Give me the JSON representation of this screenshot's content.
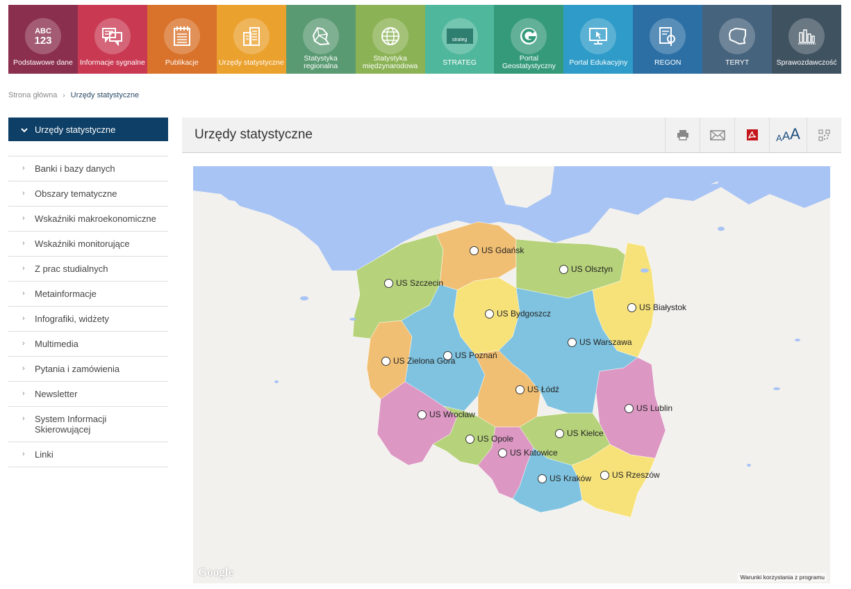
{
  "tiles": [
    {
      "label": "Podstawowe dane",
      "color": "#8b2f4f",
      "icon": "abc-123-icon",
      "icon_text": "ABC\n123"
    },
    {
      "label": "Informacje sygnalne",
      "color": "#c93a52",
      "icon": "chat-icon"
    },
    {
      "label": "Publikacje",
      "color": "#d9722a",
      "icon": "notebook-icon"
    },
    {
      "label": "Urzędy statystyczne",
      "color": "#eba12e",
      "icon": "buildings-icon"
    },
    {
      "label": "Statystyka regionalna",
      "color": "#5a9a72",
      "icon": "map-regions-icon"
    },
    {
      "label": "Statystyka międzynarodowa",
      "color": "#8bb254",
      "icon": "globe-icon"
    },
    {
      "label": "STRATEG",
      "color": "#4fb79b",
      "icon": "strateg-icon",
      "icon_text": "strateg"
    },
    {
      "label": "Portal Geostatystyczny",
      "color": "#359a7a",
      "icon": "geo-g-icon"
    },
    {
      "label": "Portal Edukacyjny",
      "color": "#2e9bc8",
      "icon": "monitor-cursor-icon"
    },
    {
      "label": "REGON",
      "color": "#2b6fa5",
      "icon": "document-search-icon"
    },
    {
      "label": "TERYT",
      "color": "#46637d",
      "icon": "poland-outline-icon"
    },
    {
      "label": "Sprawozdawczość",
      "color": "#3f5260",
      "icon": "bar-chart-icon"
    }
  ],
  "breadcrumb": {
    "home": "Strona główna",
    "current": "Urzędy statystyczne"
  },
  "sidebar": {
    "active": "Urzędy statystyczne",
    "items": [
      "Banki i bazy danych",
      "Obszary tematyczne",
      "Wskaźniki makroekonomiczne",
      "Wskaźniki monitorujące",
      "Z prac studialnych",
      "Metainformacje",
      "Infografiki, widżety",
      "Multimedia",
      "Pytania i zamówienia",
      "Newsletter",
      "System Informacji Skierowującej",
      "Linki"
    ]
  },
  "content": {
    "title": "Urzędy statystyczne"
  },
  "tools": {
    "font_small": "A",
    "font_medium": "A",
    "font_large": "A"
  },
  "map": {
    "offices": [
      {
        "name": "US Gdańsk"
      },
      {
        "name": "US Olsztyn"
      },
      {
        "name": "US Szczecin"
      },
      {
        "name": "US Białystok"
      },
      {
        "name": "US Bydgoszcz"
      },
      {
        "name": "US Warszawa"
      },
      {
        "name": "US Zielona Góra"
      },
      {
        "name": "US Poznań"
      },
      {
        "name": "US Łódź"
      },
      {
        "name": "US Lublin"
      },
      {
        "name": "US Wrocław"
      },
      {
        "name": "US Kielce"
      },
      {
        "name": "US Opole"
      },
      {
        "name": "US Katowice"
      },
      {
        "name": "US Kraków"
      },
      {
        "name": "US Rzeszów"
      }
    ],
    "logo": "Google",
    "terms": "Warunki korzystania z programu"
  }
}
